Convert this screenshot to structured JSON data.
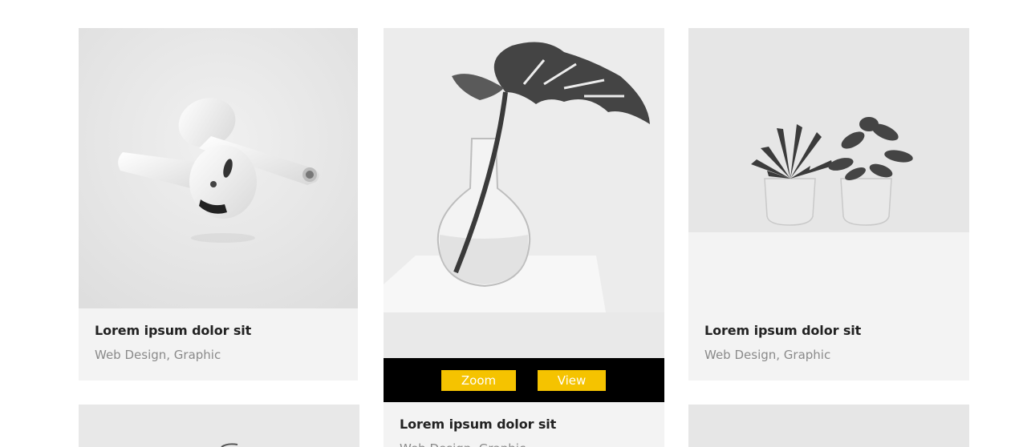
{
  "portfolio": {
    "cards": [
      {
        "title": "Lorem ipsum dolor sit",
        "categories": "Web Design, Graphic",
        "image_icon": "earbuds-icon"
      },
      {
        "title": "Lorem ipsum dolor sit",
        "categories": "Web Design, Graphic",
        "image_icon": "monstera-vase-icon",
        "actions": {
          "zoom_label": "Zoom",
          "view_label": "View"
        },
        "accent_color": "#f5c300"
      },
      {
        "title": "Lorem ipsum dolor sit",
        "categories": "Web Design, Graphic",
        "image_icon": "succulent-pots-icon"
      }
    ]
  }
}
